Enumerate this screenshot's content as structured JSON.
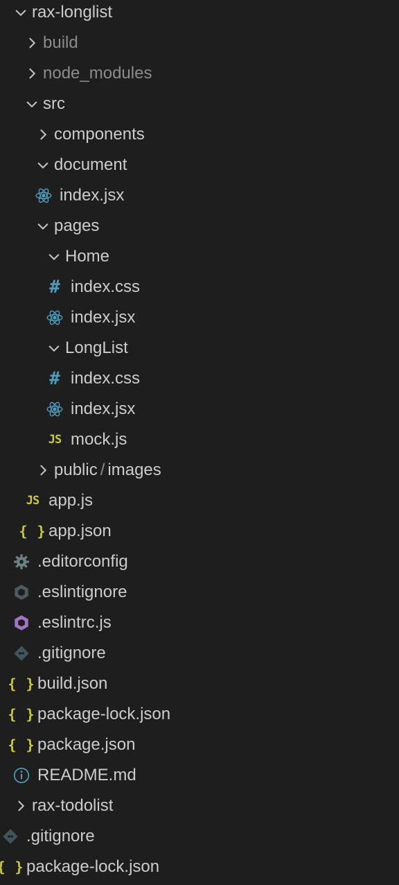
{
  "explorer": {
    "items": [
      {
        "label": "rax-longlist",
        "type": "folder",
        "expanded": true,
        "depth": 0,
        "dim": false
      },
      {
        "label": "build",
        "type": "folder",
        "expanded": false,
        "depth": 1,
        "dim": true
      },
      {
        "label": "node_modules",
        "type": "folder",
        "expanded": false,
        "depth": 1,
        "dim": true
      },
      {
        "label": "src",
        "type": "folder",
        "expanded": true,
        "depth": 1,
        "dim": false
      },
      {
        "label": "components",
        "type": "folder",
        "expanded": false,
        "depth": 2,
        "dim": false
      },
      {
        "label": "document",
        "type": "folder",
        "expanded": true,
        "depth": 2,
        "dim": false
      },
      {
        "label": "index.jsx",
        "type": "file",
        "icon": "react-icon",
        "depth": 2,
        "dim": false
      },
      {
        "label": "pages",
        "type": "folder",
        "expanded": true,
        "depth": 2,
        "dim": false
      },
      {
        "label": "Home",
        "type": "folder",
        "expanded": true,
        "depth": 3,
        "dim": false
      },
      {
        "label": "index.css",
        "type": "file",
        "icon": "css-hash-icon",
        "depth": 3,
        "dim": false
      },
      {
        "label": "index.jsx",
        "type": "file",
        "icon": "react-icon",
        "depth": 3,
        "dim": false
      },
      {
        "label": "LongList",
        "type": "folder",
        "expanded": true,
        "depth": 3,
        "dim": false
      },
      {
        "label": "index.css",
        "type": "file",
        "icon": "css-hash-icon",
        "depth": 3,
        "dim": false
      },
      {
        "label": "index.jsx",
        "type": "file",
        "icon": "react-icon",
        "depth": 3,
        "dim": false
      },
      {
        "label": "mock.js",
        "type": "file",
        "icon": "js-icon",
        "depth": 3,
        "dim": false
      },
      {
        "label": "public",
        "label_suffix": "images",
        "type": "folder",
        "expanded": false,
        "depth": 2,
        "dim": false
      },
      {
        "label": "app.js",
        "type": "file",
        "icon": "js-icon",
        "depth": 1,
        "dim": false
      },
      {
        "label": "app.json",
        "type": "file",
        "icon": "json-icon",
        "depth": 1,
        "dim": false
      },
      {
        "label": ".editorconfig",
        "type": "file",
        "icon": "gear-icon",
        "depth": 0,
        "dim": false
      },
      {
        "label": ".eslintignore",
        "type": "file",
        "icon": "eslint-ignore-icon",
        "depth": 0,
        "dim": false
      },
      {
        "label": ".eslintrc.js",
        "type": "file",
        "icon": "eslint-icon",
        "depth": 0,
        "dim": false
      },
      {
        "label": ".gitignore",
        "type": "file",
        "icon": "git-icon",
        "depth": 0,
        "dim": false
      },
      {
        "label": "build.json",
        "type": "file",
        "icon": "json-icon",
        "depth": 0,
        "dim": false
      },
      {
        "label": "package-lock.json",
        "type": "file",
        "icon": "json-icon",
        "depth": 0,
        "dim": false
      },
      {
        "label": "package.json",
        "type": "file",
        "icon": "json-icon",
        "depth": 0,
        "dim": false
      },
      {
        "label": "README.md",
        "type": "file",
        "icon": "info-icon",
        "depth": 0,
        "dim": false
      },
      {
        "label": "rax-todolist",
        "type": "folder",
        "expanded": false,
        "depth": 0,
        "dim": false
      },
      {
        "label": ".gitignore",
        "type": "file",
        "icon": "git-icon",
        "depth": -1,
        "dim": false
      },
      {
        "label": "package-lock.json",
        "type": "file",
        "icon": "json-icon",
        "depth": -1,
        "dim": false
      }
    ]
  },
  "colors": {
    "background": "#1e1e1e",
    "text": "#cccccc",
    "dim_text": "#8c8c8c",
    "chevron": "#c5c5c5",
    "react": "#519aba",
    "css": "#519aba",
    "js": "#cbcb41",
    "json": "#cbcb41",
    "gear": "#6d8086",
    "eslint": "#a074c4",
    "eslint_ignore": "#4d5a5e",
    "git": "#41535b",
    "info": "#519aba"
  }
}
